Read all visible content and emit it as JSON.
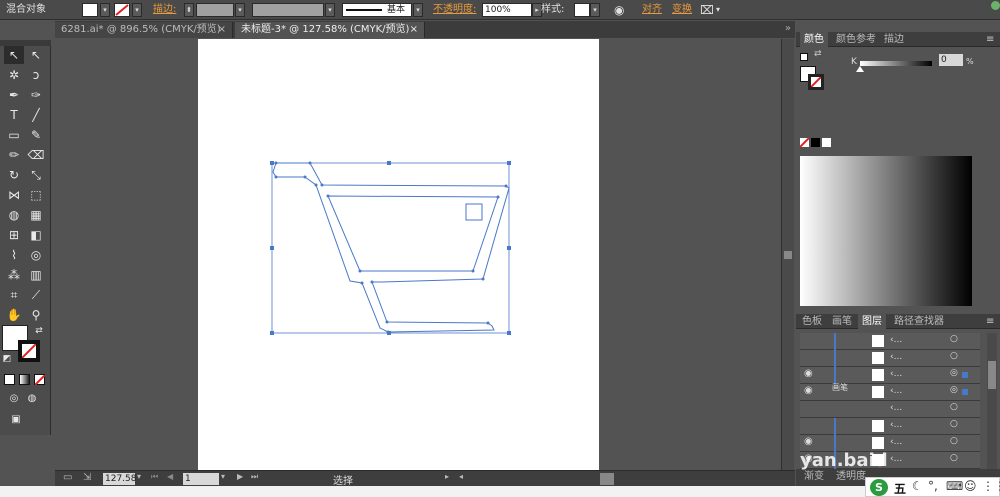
{
  "control_bar": {
    "object_type": "混合对象",
    "stroke_label": "描边:",
    "stroke_style": "基本",
    "opacity_label": "不透明度:",
    "opacity_value": "100%",
    "style_label": "样式:",
    "align_label": "对齐",
    "transform_label": "变换"
  },
  "tabs": [
    {
      "label": "6281.ai* @ 896.5% (CMYK/预览)"
    },
    {
      "label": "未标题-3* @ 127.58% (CMYK/预览)"
    }
  ],
  "tab_close": "×",
  "status": {
    "zoom": "127.58",
    "page": "1",
    "tool": "选择"
  },
  "color_panel": {
    "tabs": [
      "颜色",
      "颜色参考",
      "描边"
    ],
    "k_label": "K",
    "k_value": "0",
    "percent": "%"
  },
  "layers_panel": {
    "tabs": [
      "色板",
      "画笔",
      "图层",
      "路径查找器"
    ],
    "row_label": "‹...",
    "overlay_text": "画笔"
  },
  "bottom_panel": {
    "tabs": [
      "渐变",
      "透明度"
    ]
  },
  "watermark": "yan.baid",
  "taskbar": {
    "ime_label": "五"
  },
  "colors": {
    "ui_bg": "#535353",
    "path": "#4a78c8",
    "accent": "#e89a3c"
  }
}
